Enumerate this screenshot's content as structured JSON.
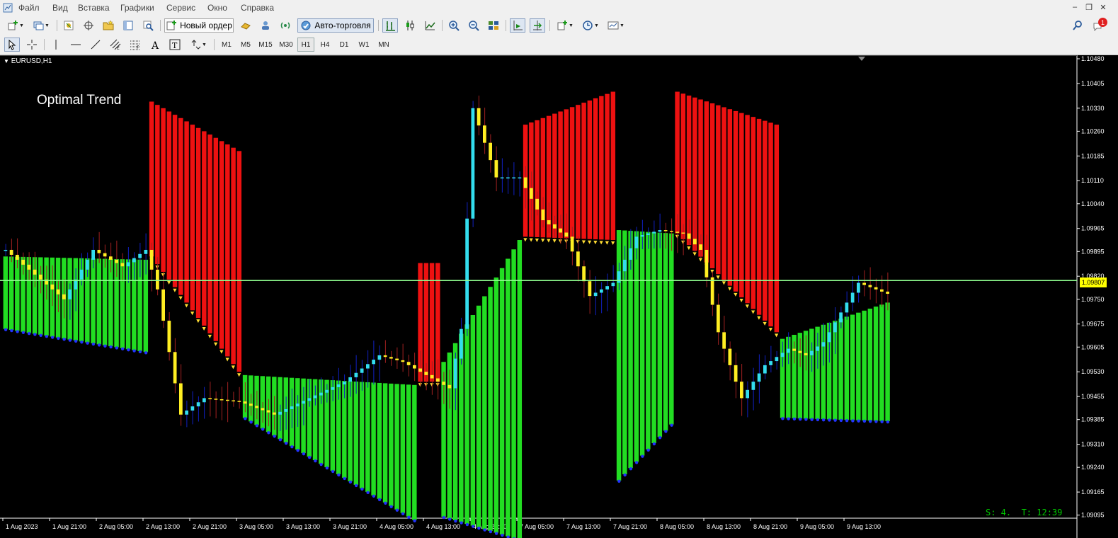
{
  "menu": {
    "items": [
      "Файл",
      "Вид",
      "Вставка",
      "Графики",
      "Сервис",
      "Окно",
      "Справка"
    ]
  },
  "toolbar": {
    "new_order_label": "Новый ордер",
    "auto_trading_label": "Авто-торговля",
    "notification_count": "1",
    "timeframes": [
      "M1",
      "M5",
      "M15",
      "M30",
      "H1",
      "H4",
      "D1",
      "W1",
      "MN"
    ],
    "selected_timeframe": "H1"
  },
  "chart": {
    "symbol_tab": "EURUSD,H1",
    "indicator_name": "Optimal Trend",
    "status_text": "S: 4.  T: 12:39",
    "current_price_label": "1.09807",
    "current_price": 1.09807
  },
  "chart_data": {
    "type": "candlestick",
    "symbol": "EURUSD",
    "timeframe": "H1",
    "ylim": [
      1.0909,
      1.1048
    ],
    "y_ticks": [
      "1.10480",
      "1.10405",
      "1.10330",
      "1.10260",
      "1.10185",
      "1.10110",
      "1.10040",
      "1.09965",
      "1.09895",
      "1.09820",
      "1.09750",
      "1.09675",
      "1.09605",
      "1.09530",
      "1.09455",
      "1.09385",
      "1.09310",
      "1.09240",
      "1.09165",
      "1.09095"
    ],
    "x_ticks": [
      "1 Aug 2023",
      "1 Aug 21:00",
      "2 Aug 05:00",
      "2 Aug 13:00",
      "2 Aug 21:00",
      "3 Aug 05:00",
      "3 Aug 13:00",
      "3 Aug 21:00",
      "4 Aug 05:00",
      "4 Aug 13:00",
      "4 Aug 21:00",
      "7 Aug 05:00",
      "7 Aug 13:00",
      "7 Aug 21:00",
      "8 Aug 05:00",
      "8 Aug 13:00",
      "8 Aug 21:00",
      "9 Aug 05:00",
      "9 Aug 13:00"
    ],
    "bars_per_tick": 8,
    "horizontal_line": 1.09807,
    "colors": {
      "background": "#000000",
      "grid_axis": "#ffffff",
      "bull_candle": "#33ddee",
      "bear_candle": "#ffee22",
      "wick": "#1020c0",
      "red_band": "#ee1111",
      "green_band": "#22dd22",
      "price_line": "#90ff90",
      "dot_marker": "#2233ff",
      "arrow_marker": "#ffdd33"
    },
    "segments": [
      {
        "color": "green",
        "from": [
          1.0988,
          1.0966
        ],
        "to": [
          1.0987,
          1.0959
        ],
        "bars": 25
      },
      {
        "color": "red",
        "from": [
          1.1035,
          1.0988
        ],
        "to": [
          1.102,
          1.0953
        ],
        "bars": 16
      },
      {
        "color": "green",
        "from": [
          1.0952,
          1.0939
        ],
        "to": [
          1.0949,
          1.0908
        ],
        "bars": 30
      },
      {
        "color": "red",
        "from": [
          1.0986,
          1.095
        ],
        "to": [
          1.0986,
          1.095
        ],
        "bars": 4
      },
      {
        "color": "green",
        "from": [
          1.0956,
          1.0909
        ],
        "to": [
          1.0993,
          1.0902
        ],
        "bars": 14
      },
      {
        "color": "red",
        "from": [
          1.1028,
          1.0994
        ],
        "to": [
          1.1038,
          1.0993
        ],
        "bars": 16
      },
      {
        "color": "green",
        "from": [
          1.0996,
          1.092
        ],
        "to": [
          1.0995,
          1.0937
        ],
        "bars": 10
      },
      {
        "color": "red",
        "from": [
          1.1038,
          1.0995
        ],
        "to": [
          1.1028,
          1.0965
        ],
        "bars": 18
      },
      {
        "color": "green",
        "from": [
          1.0963,
          1.0939
        ],
        "to": [
          1.0974,
          1.0938
        ],
        "bars": 19
      }
    ],
    "close_path": [
      [
        0,
        1.099
      ],
      [
        10,
        1.0975
      ],
      [
        15,
        1.099
      ],
      [
        20,
        1.0985
      ],
      [
        24,
        1.099
      ],
      [
        26,
        1.0978
      ],
      [
        30,
        1.094
      ],
      [
        34,
        1.0945
      ],
      [
        40,
        1.0944
      ],
      [
        46,
        1.094
      ],
      [
        52,
        1.0945
      ],
      [
        58,
        1.095
      ],
      [
        64,
        1.0958
      ],
      [
        68,
        1.0956
      ],
      [
        72,
        1.0952
      ],
      [
        76,
        1.0948
      ],
      [
        78,
        1.0966
      ],
      [
        80,
        1.1033
      ],
      [
        84,
        1.1012
      ],
      [
        88,
        1.1012
      ],
      [
        92,
        1.0999
      ],
      [
        96,
        1.0994
      ],
      [
        100,
        1.0976
      ],
      [
        104,
        1.098
      ],
      [
        108,
        1.0994
      ],
      [
        112,
        1.0996
      ],
      [
        116,
        1.0995
      ],
      [
        119,
        1.099
      ],
      [
        122,
        1.0965
      ],
      [
        126,
        1.0945
      ],
      [
        130,
        1.0955
      ],
      [
        134,
        1.096
      ],
      [
        137,
        1.0958
      ],
      [
        140,
        1.0962
      ],
      [
        146,
        1.098
      ],
      [
        152,
        1.0976
      ],
      [
        156,
        1.0981
      ]
    ]
  }
}
